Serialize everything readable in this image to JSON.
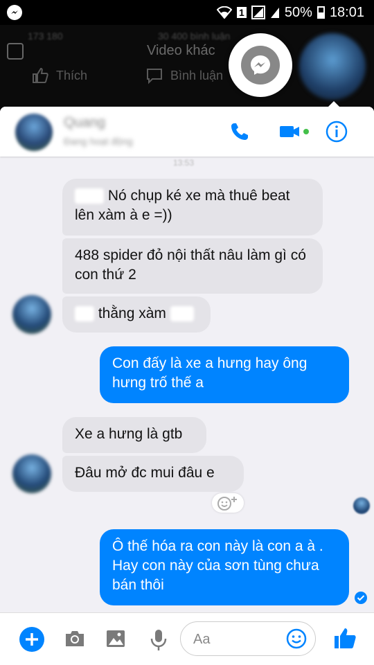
{
  "status_bar": {
    "sim_slot": "1",
    "battery": "50%",
    "time": "18:01"
  },
  "background": {
    "counts_left": "173 180",
    "counts_right": "30 400 bình luận",
    "title": "Video khác",
    "like_label": "Thích",
    "comment_label": "Bình luận"
  },
  "header": {
    "contact_name": "Quang",
    "contact_status": "Đang hoạt động",
    "phone_color": "#0084ff",
    "active_color": "#44c04a"
  },
  "timestamp": "13:53",
  "messages": [
    {
      "dir": "in",
      "text": "Nó chụp ké xe mà thuê beat lên xàm  à e =))"
    },
    {
      "dir": "in",
      "text": "488 spider đỏ nội thất nâu làm gì có con thứ 2"
    },
    {
      "dir": "in",
      "text": "thằng xàm"
    },
    {
      "dir": "out",
      "text": "Con đấy là xe a hưng hay ông hưng trố thế a"
    },
    {
      "dir": "in",
      "text": "Xe a hưng là gtb"
    },
    {
      "dir": "in",
      "text": "Đâu mở đc mui đâu e"
    },
    {
      "dir": "out",
      "text": "Ô thế hóa ra con này là con a à . Hay con này của sơn tùng chưa bán thôi"
    }
  ],
  "composer": {
    "placeholder": "Aa"
  },
  "colors": {
    "outgoing": "#0084ff",
    "incoming": "#e4e3e8",
    "panel_bg": "#f1f0f5"
  }
}
